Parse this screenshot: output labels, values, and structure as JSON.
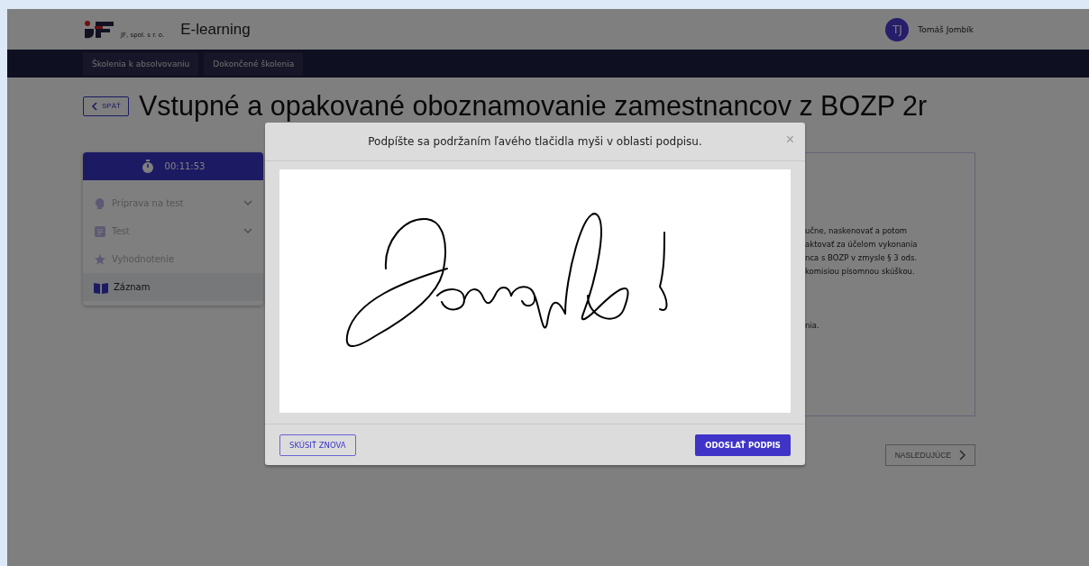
{
  "header": {
    "logo_text": "JF, spol. s r. o.",
    "app_title": "E-learning",
    "user": {
      "initials": "TJ",
      "name": "Tomáš Jombík"
    }
  },
  "nav_tabs": [
    {
      "label": "Školenia k absolvovaniu"
    },
    {
      "label": "Dokončené školenia"
    }
  ],
  "back_button": "SPÄŤ",
  "page_title": "Vstupné a opakované oboznamovanie zamestnancov z BOZP 2r",
  "sidebar": {
    "timer": "00:11:53",
    "items": [
      {
        "label": "Príprava na test",
        "expandable": true,
        "selected": false
      },
      {
        "label": "Test",
        "expandable": true,
        "selected": false
      },
      {
        "label": "Vyhodnotenie",
        "expandable": false,
        "selected": false
      },
      {
        "label": "Záznam",
        "expandable": false,
        "selected": true
      }
    ]
  },
  "content_lines": [
    "učne, naskenovať a potom",
    "aktovať za účelom vykonania",
    "nca s BOZP v zmysle § 3 ods.",
    "komisiou písomnou skúškou.",
    "nia."
  ],
  "next_button": {
    "label": "NASLEDUJÚCE",
    "disabled": true
  },
  "modal": {
    "title": "Podpíšte sa podržaním ľavého tlačidla myši v oblasti podpisu.",
    "close": "×",
    "retry_button": "SKÚSIŤ ZNOVA",
    "submit_button": "ODOSLAŤ PODPIS"
  }
}
